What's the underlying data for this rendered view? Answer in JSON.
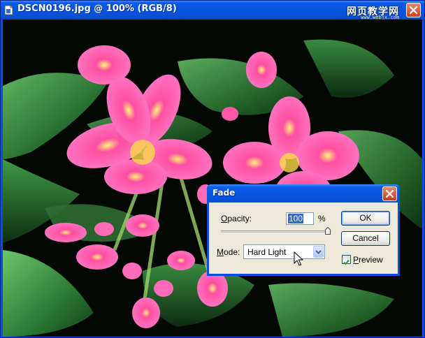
{
  "window": {
    "title": "DSCN0196.jpg @ 100% (RGB/8)",
    "watermark": "网页教学网",
    "watermark_url": "www.webjx.com"
  },
  "dialog": {
    "title": "Fade",
    "opacity_label": "Opacity:",
    "opacity_value": "100",
    "opacity_unit": "%",
    "opacity_slider_percent": 100,
    "mode_label": "Mode:",
    "mode_value": "Hard Light",
    "ok_label": "OK",
    "cancel_label": "Cancel",
    "preview_label": "Preview",
    "preview_checked": true
  },
  "icons": {
    "document": "photoshop-document-icon",
    "close": "close-icon",
    "dropdown": "chevron-down-icon",
    "check": "check-icon",
    "cursor": "mouse-pointer-icon"
  },
  "colors": {
    "titlebar": "#0a59e8",
    "dialog_bg": "#ece9d8",
    "flower_pink": "#ff5fb8",
    "leaf_green": "#2f8a3c"
  }
}
